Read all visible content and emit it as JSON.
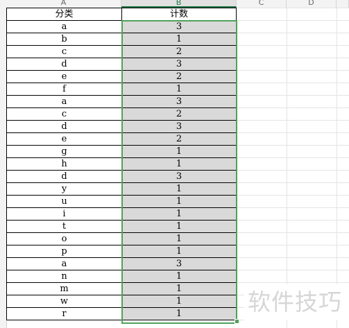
{
  "columns": [
    {
      "label": "A"
    },
    {
      "label": "B"
    },
    {
      "label": "C"
    },
    {
      "label": "D"
    }
  ],
  "table": {
    "headers": {
      "category": "分类",
      "count": "计数"
    },
    "rows": [
      {
        "category": "a",
        "count": "3"
      },
      {
        "category": "b",
        "count": "1"
      },
      {
        "category": "c",
        "count": "2"
      },
      {
        "category": "d",
        "count": "3"
      },
      {
        "category": "e",
        "count": "2"
      },
      {
        "category": "f",
        "count": "1"
      },
      {
        "category": "a",
        "count": "3"
      },
      {
        "category": "c",
        "count": "2"
      },
      {
        "category": "d",
        "count": "3"
      },
      {
        "category": "e",
        "count": "2"
      },
      {
        "category": "g",
        "count": "1"
      },
      {
        "category": "h",
        "count": "1"
      },
      {
        "category": "d",
        "count": "3"
      },
      {
        "category": "y",
        "count": "1"
      },
      {
        "category": "u",
        "count": "1"
      },
      {
        "category": "i",
        "count": "1"
      },
      {
        "category": "t",
        "count": "1"
      },
      {
        "category": "o",
        "count": "1"
      },
      {
        "category": "p",
        "count": "1"
      },
      {
        "category": "a",
        "count": "3"
      },
      {
        "category": "n",
        "count": "1"
      },
      {
        "category": "m",
        "count": "1"
      },
      {
        "category": "w",
        "count": "1"
      },
      {
        "category": "r",
        "count": "1"
      }
    ]
  },
  "colors": {
    "selection": "#4ea25a",
    "selected_fill": "#d9d9d9",
    "header_selected_text": "#217346"
  },
  "watermark": "软件技巧"
}
